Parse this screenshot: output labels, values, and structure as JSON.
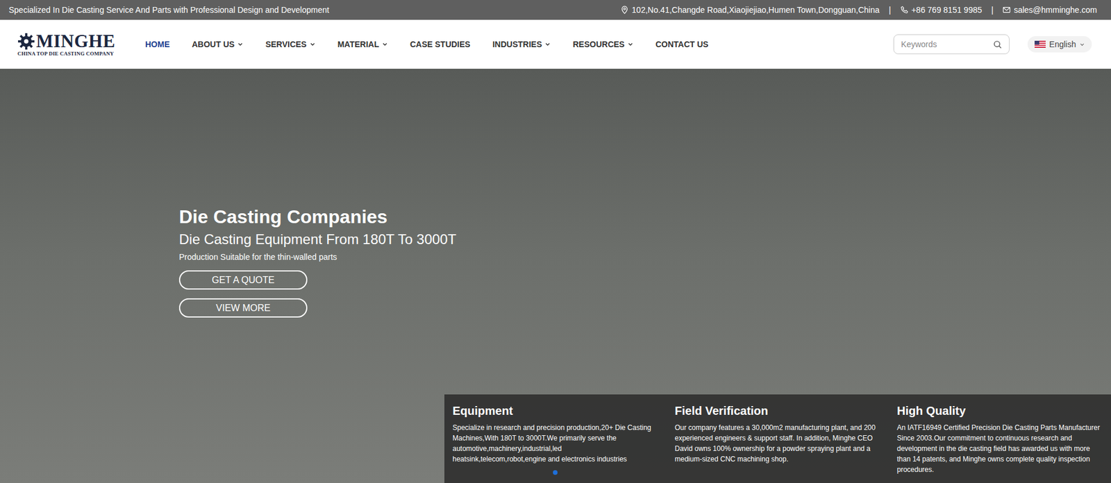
{
  "top_bar": {
    "tagline": "Specialized In Die Casting Service And Parts with Professional Design and Development",
    "address": "102,No.41,Changde Road,Xiaojiejiao,Humen Town,Dongguan,China",
    "separators": [
      "|",
      "|"
    ],
    "phone": "+86 769 8151 9985",
    "email": "sales@hmminghe.com"
  },
  "logo": {
    "name": "MINGHE",
    "subtitle": "CHINA TOP DIE CASTING COMPANY"
  },
  "nav": [
    {
      "label": "HOME",
      "selected": true,
      "dropdown": false
    },
    {
      "label": "ABOUT US",
      "selected": false,
      "dropdown": true
    },
    {
      "label": "SERVICES",
      "selected": false,
      "dropdown": true
    },
    {
      "label": "MATERIAL",
      "selected": false,
      "dropdown": true
    },
    {
      "label": "CASE STUDIES",
      "selected": false,
      "dropdown": false
    },
    {
      "label": "INDUSTRIES",
      "selected": false,
      "dropdown": true
    },
    {
      "label": "RESOURCES",
      "selected": false,
      "dropdown": true
    },
    {
      "label": "CONTACT US",
      "selected": false,
      "dropdown": false
    }
  ],
  "search": {
    "placeholder": "Keywords"
  },
  "language": {
    "label": "English"
  },
  "hero": {
    "title": "Die Casting Companies",
    "subtitle": "Die Casting Equipment From 180T To 3000T",
    "caption": "Production Suitable for the thin-walled parts",
    "buttons": [
      "GET A QUOTE",
      "VIEW MORE"
    ],
    "slides": [
      {
        "selected": true
      }
    ]
  },
  "features": [
    {
      "title": "Equipment",
      "text": "Specialize in research and precision production,20+ Die Casting Machines,With 180T to 3000T.We primarily serve the automotive,machinery,industrial,led heatsink,telecom,robot,engine and electronics industries"
    },
    {
      "title": "Field Verification",
      "text": "Our company features a 30,000m2 manufacturing plant, and 200 experienced engineers & support staff. In addition, Minghe CEO David owns 100% ownership for a powder spraying plant and a medium-sized CNC machining shop."
    },
    {
      "title": "High Quality",
      "text": "An IATF16949 Certified Precision Die Casting Parts Manufacturer Since 2003.Our commitment to continuous research and development in the die casting field has awarded us with more than 14 patents, and Minghe owns complete quality inspection procedures."
    }
  ]
}
